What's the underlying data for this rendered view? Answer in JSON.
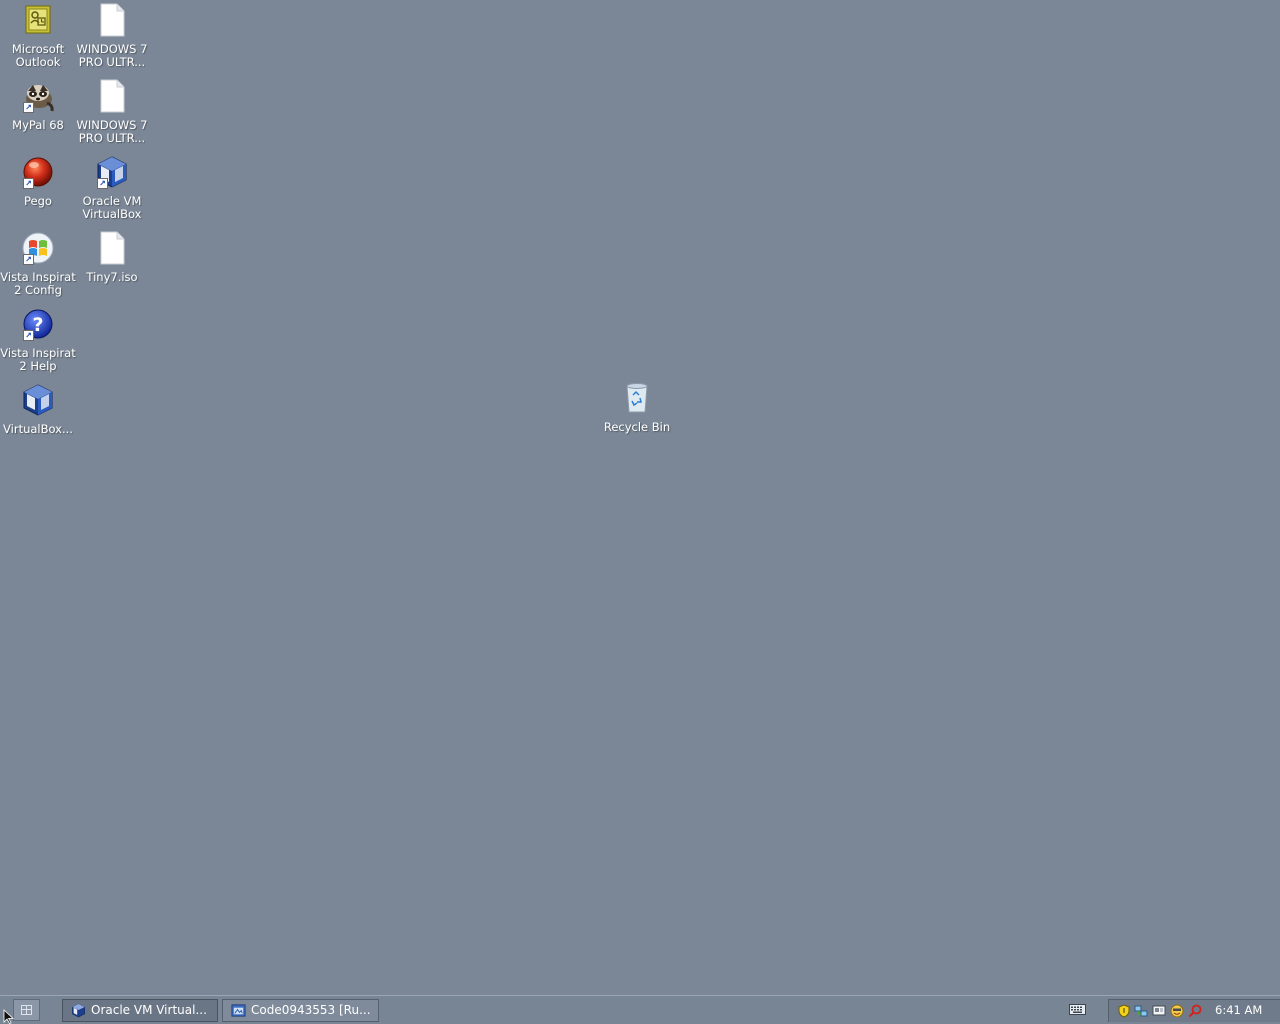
{
  "desktop": {
    "background_color": "#7b8796",
    "icons": [
      {
        "name": "desktop-icon-microsoft-outlook",
        "icon": "outlook-icon",
        "label": "Microsoft\nOutlook",
        "shortcut": false
      },
      {
        "name": "desktop-icon-windows7-pro-1",
        "icon": "document-icon",
        "label": "WINDOWS 7\nPRO ULTR...",
        "shortcut": false
      },
      {
        "name": "desktop-icon-mypal",
        "icon": "raccoon-icon",
        "label": "MyPal 68",
        "shortcut": true
      },
      {
        "name": "desktop-icon-windows7-pro-2",
        "icon": "document-icon",
        "label": "WINDOWS 7\nPRO ULTR...",
        "shortcut": false
      },
      {
        "name": "desktop-icon-pego",
        "icon": "red-orb-icon",
        "label": "Pego",
        "shortcut": true
      },
      {
        "name": "desktop-icon-oracle-vm-virtualbox",
        "icon": "virtualbox-icon",
        "label": "Oracle VM\nVirtualBox",
        "shortcut": true
      },
      {
        "name": "desktop-icon-vista-inspirat-config",
        "icon": "windows-logo-icon",
        "label": "Vista Inspirat\n2 Config",
        "shortcut": true
      },
      {
        "name": "desktop-icon-tiny7-iso",
        "icon": "document-icon",
        "label": "Tiny7.iso",
        "shortcut": false
      },
      {
        "name": "desktop-icon-vista-inspirat-help",
        "icon": "help-icon",
        "label": "Vista Inspirat\n2 Help",
        "shortcut": true
      },
      {
        "name": "desktop-icon-virtualbox",
        "icon": "virtualbox-icon",
        "label": "VirtualBox...",
        "shortcut": false
      },
      {
        "name": "desktop-icon-recycle-bin",
        "icon": "recycle-bin-icon",
        "label": "Recycle Bin",
        "shortcut": false
      }
    ]
  },
  "taskbar": {
    "start_icon": "start-grid-icon",
    "tasks": [
      {
        "label": "Oracle VM Virtual...",
        "icon": "virtualbox-icon",
        "active": true
      },
      {
        "label": "Code0943553 [Ru...",
        "icon": "vm-window-icon",
        "active": false
      }
    ],
    "keyboard_icon": "keyboard-icon",
    "tray_icons": [
      "shield-icon",
      "network-icon",
      "display-icon",
      "smiley-icon",
      "magnifier-icon"
    ],
    "clock": "6:41 AM"
  }
}
